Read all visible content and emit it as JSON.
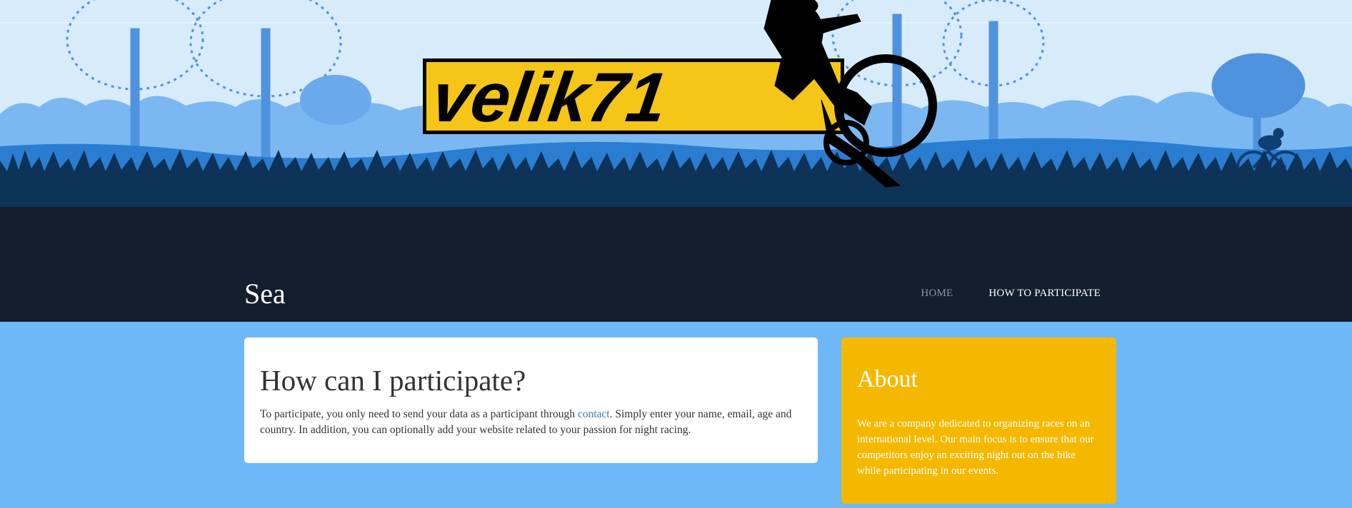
{
  "colors": {
    "header_bg": "#121f2e",
    "sky": "#d8ebfb",
    "page_bg": "#6fb8f7",
    "logo_yellow": "#f5c518",
    "about_bg": "#f5b800",
    "link": "#337ab7"
  },
  "header": {
    "logo_text": "velik71",
    "site_title": "Sea",
    "nav": [
      {
        "label": "HOME"
      },
      {
        "label": "HOW TO PARTICIPATE"
      }
    ]
  },
  "main": {
    "title": "How can I participate?",
    "text_before": "To participate, you only need to send your data as a participant through ",
    "link_text": "contact",
    "text_after": ". Simply enter your name, email, age and country. In addition, you can optionally add your website related to your passion for night racing."
  },
  "sidebar": {
    "title": "About",
    "text": "We are a company dedicated to organizing races on an international level. Our main focus is to ensure that our competitors enjoy an exciting night out on the bike while participating in our events."
  }
}
